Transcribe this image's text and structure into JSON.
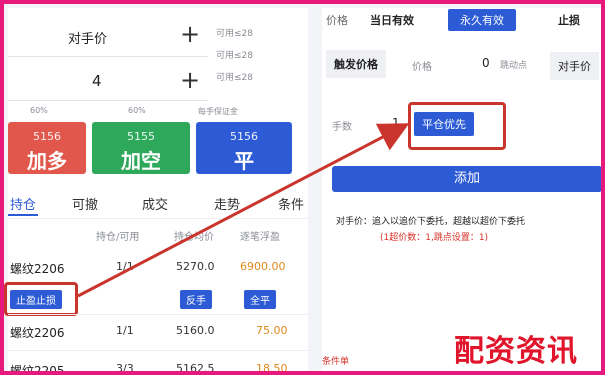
{
  "left": {
    "counterparty_label": "对手价",
    "plus_symbol": "+",
    "qty_value": "4",
    "side_info": [
      "可用≤28",
      "可用≤28",
      "可用≤28"
    ],
    "small_labels": [
      "60%",
      "60%",
      "每手保证金"
    ],
    "big_buttons": [
      {
        "price": "5156",
        "label": "加多",
        "color": "#e2574c"
      },
      {
        "price": "5155",
        "label": "加空",
        "color": "#2ea85a"
      },
      {
        "price": "5156",
        "label": "平",
        "color": "#2d5bd6"
      }
    ],
    "tabs": [
      "持仓",
      "可撤",
      "成交",
      "走势",
      "条件"
    ],
    "col_headers": [
      "持仓/可用",
      "持仓均价",
      "逐笔浮盈"
    ],
    "rows": [
      {
        "name": "螺纹2206",
        "qty": "1/1",
        "price": "5270.0",
        "pnl": "6900.00"
      },
      {
        "name": "螺纹2206",
        "qty": "1/1",
        "price": "5160.0",
        "pnl": "75.00"
      },
      {
        "name": "螺纹2205",
        "qty": "3/3",
        "price": "5162.5",
        "pnl": "18.50"
      }
    ],
    "stop_button": "止盈止损",
    "row_actions": [
      "反手",
      "全平"
    ]
  },
  "right": {
    "tabs": [
      "价格",
      "当日有效",
      "永久有效",
      "止损"
    ],
    "trigger_label": "触发价格",
    "trigger_placeholder": "价格",
    "trigger_value": "0",
    "trigger_unit": "跳动点",
    "trigger_mode": "对手价",
    "qty_label": "手数",
    "qty_value": "1",
    "price_mode": "平仓优先",
    "add_button": "添加",
    "note_line1": "对手价：追入以追价下委托，超越以超价下委托",
    "note_line2": "(1超价数：1,跳点设置：1)",
    "footer_label": "条件单",
    "watermark": "配资资讯",
    "colors": {
      "accent_blue": "#2d5bd6",
      "highlight": "#c9342c",
      "frame": "#e8197d",
      "watermark": "#e0142a"
    }
  }
}
